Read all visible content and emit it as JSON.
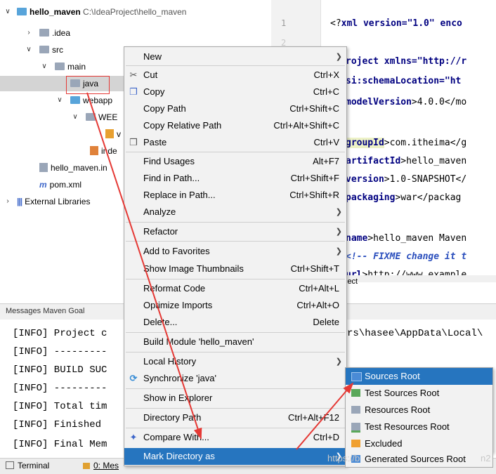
{
  "project_tree": {
    "root": {
      "name": "hello_maven",
      "path": "C:\\IdeaProject\\hello_maven"
    },
    "items": [
      {
        "label": ".idea"
      },
      {
        "label": "src"
      },
      {
        "label": "main"
      },
      {
        "label": "java"
      },
      {
        "label": "webapp"
      },
      {
        "label": "WEB-INF"
      },
      {
        "label": "web.xml"
      },
      {
        "label": "index.jsp"
      },
      {
        "label": "hello_maven.iml"
      },
      {
        "label": "pom.xml"
      },
      {
        "label": "External Libraries"
      }
    ],
    "partial": {
      "webapp": "webapp",
      "web": "WEE",
      "index": "inde",
      "iml": "hello_maven.in",
      "xml_v": "v"
    }
  },
  "editor": {
    "line_numbers": [
      "1",
      "2"
    ],
    "lines": [
      {
        "t1": "<?",
        "tag": "xml",
        "t2": " version=\"1.0\" enco"
      },
      {
        "t1": "",
        "tag": "roject",
        "t2": " xmlns=\"http://r"
      },
      {
        "t1": "",
        "tag": "si:schemaLocation=\"ht",
        "t2": ""
      },
      {
        "t1": "",
        "tag": "modelVersion",
        "t2": ">4.0.0</mo"
      },
      {
        "t1": "",
        "tag": "groupId",
        "t2": ">com.itheima</g"
      },
      {
        "t1": "",
        "tag": "artifactId",
        "t2": ">hello_maven"
      },
      {
        "t1": "",
        "tag": "version",
        "t2": ">1.0-SNAPSHOT</"
      },
      {
        "t1": "",
        "tag": "packaging",
        "t2": ">war</packag"
      },
      {
        "t1": "",
        "tag": "name",
        "t2": ">hello_maven Maven "
      },
      {
        "t1": "<!-- ",
        "tag": "FIXME change it t",
        "t2": ""
      },
      {
        "t1": "",
        "tag": "url",
        "t2": ">http://www.example"
      }
    ],
    "project_label": "ject"
  },
  "messages": {
    "title": "Messages Maven Goal",
    "lines": [
      "[INFO] Project c",
      "[INFO] ---------",
      "[INFO] BUILD SUC",
      "[INFO] ---------",
      "[INFO] Total tim",
      "[INFO] Finished",
      "[INFO] Final Mem"
    ],
    "right_text": "rs\\hasee\\AppData\\Local\\"
  },
  "status_bar": {
    "terminal": "Terminal",
    "messages": "0: Mes"
  },
  "context_menu": {
    "items": [
      {
        "label": "New",
        "shortcut": "",
        "submenu": true,
        "icon": ""
      },
      {
        "label": "Cut",
        "shortcut": "Ctrl+X",
        "icon": "scissors-icon"
      },
      {
        "label": "Copy",
        "shortcut": "Ctrl+C",
        "icon": "copy-icon"
      },
      {
        "label": "Copy Path",
        "shortcut": "Ctrl+Shift+C"
      },
      {
        "label": "Copy Relative Path",
        "shortcut": "Ctrl+Alt+Shift+C"
      },
      {
        "label": "Paste",
        "shortcut": "Ctrl+V",
        "icon": "paste-icon"
      },
      {
        "label": "Find Usages",
        "shortcut": "Alt+F7"
      },
      {
        "label": "Find in Path...",
        "shortcut": "Ctrl+Shift+F"
      },
      {
        "label": "Replace in Path...",
        "shortcut": "Ctrl+Shift+R"
      },
      {
        "label": "Analyze",
        "submenu": true
      },
      {
        "label": "Refactor",
        "submenu": true
      },
      {
        "label": "Add to Favorites",
        "submenu": true
      },
      {
        "label": "Show Image Thumbnails",
        "shortcut": "Ctrl+Shift+T"
      },
      {
        "label": "Reformat Code",
        "shortcut": "Ctrl+Alt+L"
      },
      {
        "label": "Optimize Imports",
        "shortcut": "Ctrl+Alt+O"
      },
      {
        "label": "Delete...",
        "shortcut": "Delete"
      },
      {
        "label": "Build Module 'hello_maven'"
      },
      {
        "label": "Local History",
        "submenu": true
      },
      {
        "label": "Synchronize 'java'",
        "icon": "sync-icon"
      },
      {
        "label": "Show in Explorer"
      },
      {
        "label": "Directory Path",
        "shortcut": "Ctrl+Alt+F12"
      },
      {
        "label": "Compare With...",
        "shortcut": "Ctrl+D",
        "icon": "compare-icon"
      },
      {
        "label": "Mark Directory as",
        "submenu": true,
        "active": true
      }
    ]
  },
  "mark_directory_submenu": {
    "items": [
      {
        "label": "Sources Root",
        "color": "#4a8bd6",
        "active": true
      },
      {
        "label": "Test Sources Root",
        "color": "#5aa85a"
      },
      {
        "label": "Resources Root",
        "color": "#9aa6b8"
      },
      {
        "label": "Test Resources Root",
        "color": "#9aa6b8"
      },
      {
        "label": "Excluded",
        "color": "#f0a030"
      },
      {
        "label": "Generated Sources Root",
        "color": "#4a8bd6"
      }
    ]
  },
  "watermark": "https://b",
  "watermark_tail": "n2",
  "colors": {
    "accent": "#2675bf",
    "annotation": "#e53935"
  }
}
